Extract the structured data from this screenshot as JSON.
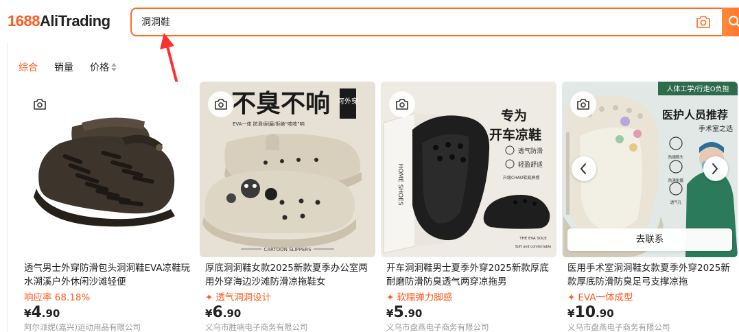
{
  "logo": {
    "num": "1688",
    "text": "AliTrading"
  },
  "search": {
    "value": "洞洞鞋"
  },
  "sort": {
    "items": [
      "综合",
      "销量",
      "价格"
    ]
  },
  "products": [
    {
      "title": "透气男士外穿防滑包头洞洞鞋EVA凉鞋玩水溯溪户外休闲沙滩轻便",
      "tag": "响应率 68.18%",
      "price_currency": "¥",
      "price_int": "4",
      "price_dec": ".90",
      "supplier": "阿尔派妮(嘉兴)运动用品有限公司"
    },
    {
      "title": "厚底洞洞鞋女款2025新款夏季办公室两用外穿海边沙滩防滑凉拖鞋女",
      "tag": "透气洞洞设计",
      "price_currency": "¥",
      "price_int": "6",
      "price_dec": ".90",
      "supplier": "义乌市胜喃电子商务有限公司",
      "image_text": {
        "headline": "不臭不响",
        "badge": "可外穿",
        "sub": "EVA一体 防滑/耐磨/拒绝“吱吱”响",
        "footer": "CARTOON SLIPPERS"
      }
    },
    {
      "title": "开车洞洞鞋男士夏季外穿2025新款厚底耐磨防滑防臭透气两穿凉拖男",
      "tag": "软糯弹力脚感",
      "price_currency": "¥",
      "price_int": "5",
      "price_dec": ".90",
      "supplier": "义乌市盘燕电子商务有限公司",
      "image_text": {
        "headline1": "专为",
        "headline2": "开车凉鞋",
        "feat1": "透气防滑",
        "feat2": "轻盈舒适",
        "upgrade": "升级CHAO软底屏感",
        "box": "HOME SHOES",
        "sole": "THE EVA SOLE",
        "sole_sub": "Soft and comfortable"
      }
    },
    {
      "title": "医用手术室洞洞鞋女款夏季外穿2025新款厚底防滑防臭足弓支撑凉拖",
      "tag": "EVA一体成型",
      "price_currency": "¥",
      "price_int": "10",
      "price_dec": ".90",
      "supplier": "义乌市盘燕电子商务有限公司",
      "hover_button": "去联系",
      "image_text": {
        "banner": "人体工学/行走O负担",
        "headline": "医护人员推荐",
        "sub": "手术室之选",
        "feat1": "防播鞋头",
        "feat2": "防滑耐磨",
        "feat3": "透气孔"
      }
    }
  ],
  "colors": {
    "accent": "#ff5a1f",
    "border": "#ff6a21"
  }
}
